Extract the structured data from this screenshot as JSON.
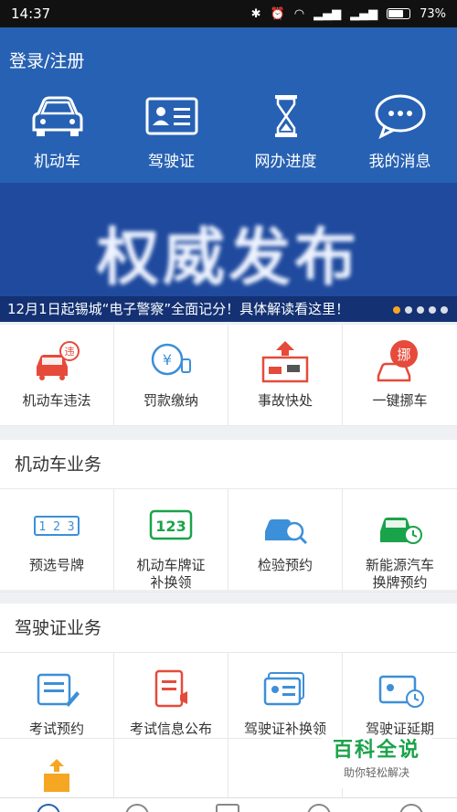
{
  "status_bar": {
    "time": "14:37",
    "battery": "73%",
    "battery_level": 0.73
  },
  "header": {
    "login": "登录/注册",
    "quick": [
      {
        "label": "机动车",
        "icon": "car-icon"
      },
      {
        "label": "驾驶证",
        "icon": "license-card-icon"
      },
      {
        "label": "网办进度",
        "icon": "hourglass-icon"
      },
      {
        "label": "我的消息",
        "icon": "chat-bubble-icon"
      }
    ]
  },
  "banner": {
    "title": "权威发布",
    "caption": "12月1日起锡城“电子警察”全面记分！具体解读看这里！",
    "dots": 5,
    "active_dot": 0
  },
  "top_grid": [
    {
      "label": "机动车违法",
      "icon": "car-violation-icon",
      "badge": "违"
    },
    {
      "label": "罚款缴纳",
      "icon": "fine-payment-icon",
      "badge": "¥"
    },
    {
      "label": "事故快处",
      "icon": "accident-icon"
    },
    {
      "label": "一键挪车",
      "icon": "move-car-icon",
      "badge": "挪"
    }
  ],
  "vehicle_section": {
    "title": "机动车业务",
    "items": [
      {
        "label": "预选号牌",
        "label2": "",
        "icon": "plate-select-icon",
        "plate_text": "1 2 3"
      },
      {
        "label": "机动车牌证",
        "label2": "补换领",
        "icon": "plate-replace-icon",
        "plate_text": "123"
      },
      {
        "label": "检验预约",
        "label2": "",
        "icon": "inspection-icon"
      },
      {
        "label": "新能源汽车",
        "label2": "换牌预约",
        "icon": "ev-plate-icon"
      }
    ]
  },
  "license_section": {
    "title": "驾驶证业务",
    "items": [
      {
        "label": "考试预约",
        "icon": "exam-booking-icon"
      },
      {
        "label": "考试信息公布",
        "icon": "exam-info-icon"
      },
      {
        "label": "驾驶证补换领",
        "icon": "license-replace-icon"
      },
      {
        "label": "驾驶证延期",
        "icon": "license-extend-icon"
      }
    ]
  },
  "watermark": {
    "title": "百科全说",
    "subtitle": "助你轻松解决"
  },
  "colors": {
    "header_blue": "#2761b3",
    "banner_blue": "#1f4a9e",
    "icon_blue": "#3c8fd9",
    "icon_red": "#e64a3b",
    "icon_green": "#1aa34a",
    "dot_active": "#f5a623"
  }
}
